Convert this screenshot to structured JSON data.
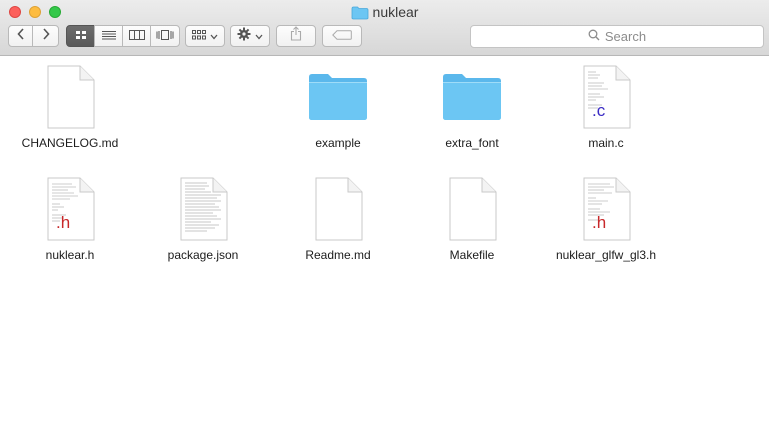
{
  "window": {
    "title": "nuklear"
  },
  "search": {
    "placeholder": "Search"
  },
  "files": [
    {
      "name": "CHANGELOG.md",
      "kind": "document"
    },
    {
      "name": "example",
      "kind": "folder"
    },
    {
      "name": "extra_font",
      "kind": "folder"
    },
    {
      "name": "main.c",
      "kind": "c-source"
    },
    {
      "name": "nuklear.h",
      "kind": "c-header"
    },
    {
      "name": "package.json",
      "kind": "text-document"
    },
    {
      "name": "Readme.md",
      "kind": "document"
    },
    {
      "name": "Makefile",
      "kind": "document"
    },
    {
      "name": "nuklear_glfw_gl3.h",
      "kind": "c-header"
    }
  ],
  "badges": {
    "c": ".c",
    "h": ".h"
  },
  "colors": {
    "folder": "#6cc6f3",
    "c_badge": "#3a2bc4",
    "h_badge": "#c8282a"
  }
}
